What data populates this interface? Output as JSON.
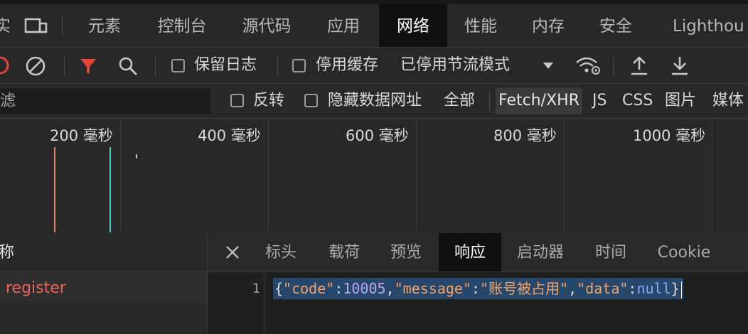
{
  "tabs": {
    "partial_left": "实",
    "elements": "元素",
    "console": "控制台",
    "sources": "源代码",
    "application": "应用",
    "network": "网络",
    "performance": "性能",
    "memory": "内存",
    "security": "安全",
    "lighthouse": "Lighthou"
  },
  "toolbar": {
    "preserve_log": "保留日志",
    "disable_cache": "停用缓存",
    "throttling": "已停用节流模式"
  },
  "filter": {
    "placeholder": "滤",
    "invert": "反转",
    "hide_data_urls": "隐藏数据网址",
    "all": "全部",
    "fetch_xhr": "Fetch/XHR",
    "js": "JS",
    "css": "CSS",
    "img": "图片",
    "media": "媒体"
  },
  "timeline": {
    "ticks": [
      "200 毫秒",
      "400 毫秒",
      "600 毫秒",
      "800 毫秒",
      "1000 毫秒"
    ],
    "markers": [
      {
        "color": "#e8855a"
      },
      {
        "color": "#4fd1c5"
      }
    ]
  },
  "requests": {
    "header": "称",
    "items": [
      {
        "name": "register",
        "color": "#f0625a"
      }
    ]
  },
  "details": {
    "tabs": [
      "标头",
      "载荷",
      "预览",
      "响应",
      "启动器",
      "时间",
      "Cookie"
    ],
    "active_tab": "响应",
    "response": {
      "line_number": "1",
      "code": 10005,
      "message": "账号被占用",
      "data": "null"
    }
  },
  "colors": {
    "filter_icon": "#e8453c",
    "error_icon": "#e8453c"
  }
}
